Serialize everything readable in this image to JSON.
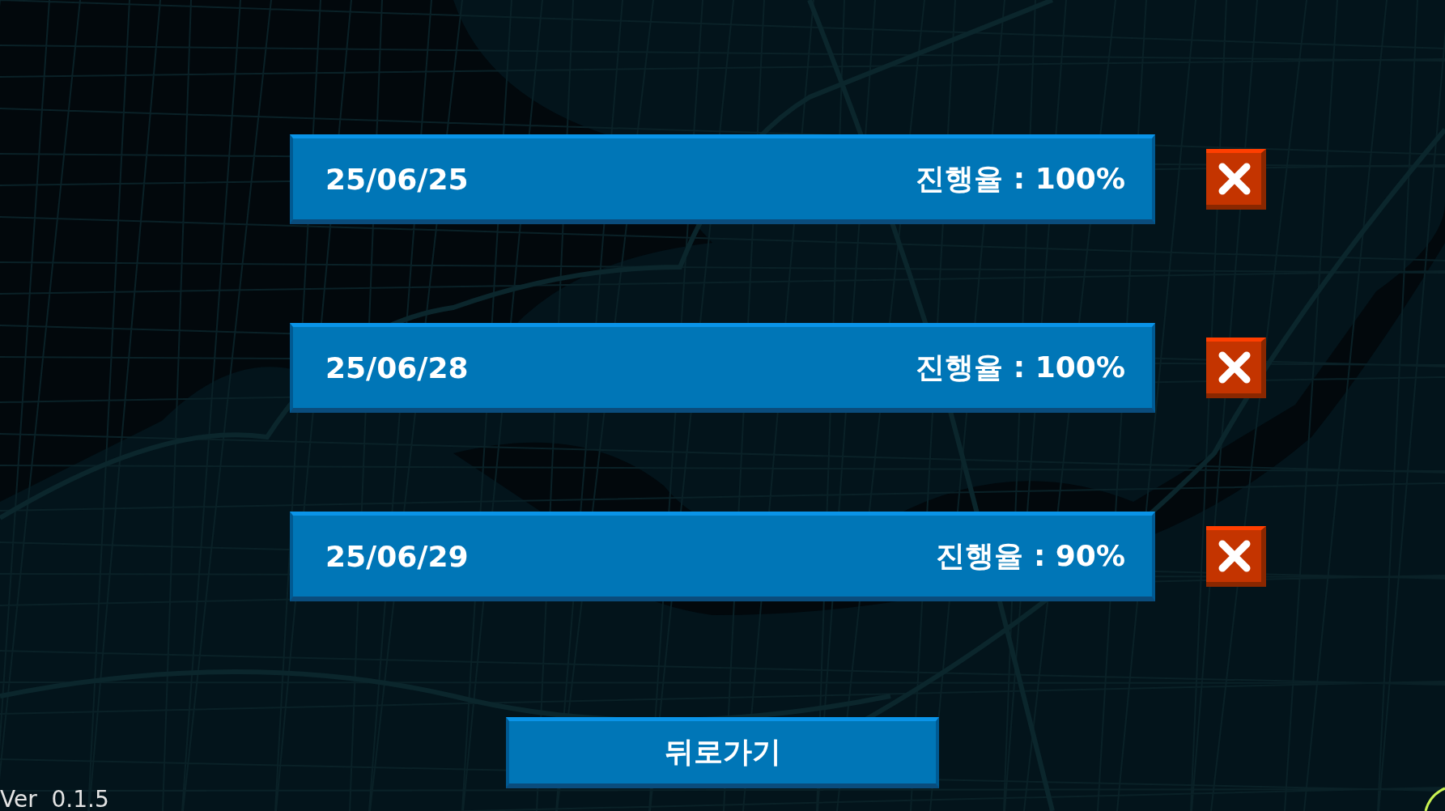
{
  "saves": [
    {
      "date": "25/06/25",
      "progress": "진행율 : 100%"
    },
    {
      "date": "25/06/28",
      "progress": "진행율 : 100%"
    },
    {
      "date": "25/06/29",
      "progress": "진행율 : 90%"
    }
  ],
  "back_button": {
    "label": "뒤로가기"
  },
  "version": "Ver  0.1.5"
}
